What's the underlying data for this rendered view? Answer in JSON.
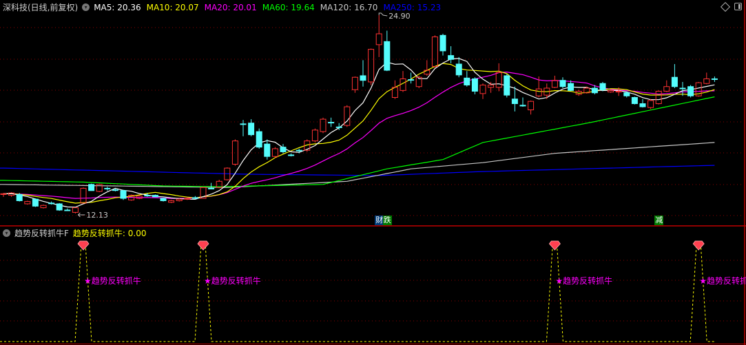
{
  "header": {
    "stock_title": "深科技(日线,前复权)",
    "ma_labels": [
      {
        "text": "MA5: 20.36",
        "color": "#FFFFFF"
      },
      {
        "text": "MA10: 20.07",
        "color": "#FFFF00"
      },
      {
        "text": "MA20: 20.01",
        "color": "#FF00FF"
      },
      {
        "text": "MA60: 19.64",
        "color": "#00FF00"
      },
      {
        "text": "MA120: 16.70",
        "color": "#C8C8C8"
      },
      {
        "text": "MA250: 15.23",
        "color": "#0000FF"
      }
    ]
  },
  "indicator": {
    "name": "趋势反转抓牛F",
    "value_label": "趋势反转抓牛: 0.00",
    "signal_text": "★趋势反转抓牛",
    "signal_indices": [
      10,
      25,
      69,
      87
    ]
  },
  "markers": [
    {
      "index": 47,
      "text": "财",
      "color": "#003C78"
    },
    {
      "index": 48,
      "text": "跌",
      "color": "#007800"
    },
    {
      "index": 82,
      "text": "减",
      "color": "#007800"
    }
  ],
  "colors": {
    "up": "#FF3232",
    "down": "#54FCFC",
    "grid": "#8B0000",
    "border": "#C00000"
  },
  "chart_data": {
    "type": "candlestick",
    "price_range": [
      12.13,
      24.9
    ],
    "high_label": "24.90",
    "low_label": "12.13",
    "ohlc": [
      [
        13.35,
        13.45,
        13.2,
        13.4
      ],
      [
        13.3,
        13.5,
        13.2,
        13.45
      ],
      [
        13.35,
        13.45,
        12.9,
        12.95
      ],
      [
        12.75,
        12.95,
        12.7,
        12.9
      ],
      [
        13.05,
        13.1,
        12.55,
        12.6
      ],
      [
        12.5,
        12.7,
        12.45,
        12.65
      ],
      [
        12.8,
        12.9,
        12.7,
        12.8
      ],
      [
        12.75,
        12.8,
        12.3,
        12.35
      ],
      [
        12.35,
        12.45,
        12.3,
        12.35
      ],
      [
        12.2,
        12.5,
        12.13,
        12.5
      ],
      [
        12.8,
        13.8,
        12.8,
        13.75
      ],
      [
        14.0,
        14.05,
        13.6,
        13.6
      ],
      [
        13.55,
        14.05,
        13.5,
        14.0
      ],
      [
        13.75,
        13.85,
        13.6,
        13.75
      ],
      [
        13.65,
        13.75,
        13.55,
        13.65
      ],
      [
        13.6,
        13.65,
        13.0,
        13.1
      ],
      [
        13.0,
        13.35,
        12.95,
        13.3
      ],
      [
        13.1,
        13.3,
        13.05,
        13.25
      ],
      [
        13.3,
        13.45,
        13.2,
        13.3
      ],
      [
        13.3,
        13.35,
        13.2,
        13.2
      ],
      [
        13.1,
        13.15,
        12.9,
        12.95
      ],
      [
        12.85,
        13.0,
        12.8,
        12.95
      ],
      [
        12.95,
        13.1,
        12.9,
        13.05
      ],
      [
        13.05,
        13.15,
        13.0,
        13.1
      ],
      [
        13.15,
        13.25,
        13.05,
        13.15
      ],
      [
        13.1,
        13.85,
        13.1,
        13.8
      ],
      [
        13.75,
        14.1,
        13.7,
        13.75
      ],
      [
        13.8,
        14.3,
        13.75,
        14.2
      ],
      [
        14.3,
        15.1,
        14.25,
        15.05
      ],
      [
        15.3,
        16.9,
        15.2,
        16.8
      ],
      [
        17.9,
        18.15,
        17.1,
        17.9
      ],
      [
        17.95,
        18.2,
        17.1,
        17.2
      ],
      [
        17.4,
        17.6,
        16.3,
        16.4
      ],
      [
        16.6,
        16.9,
        15.6,
        15.8
      ],
      [
        15.8,
        16.4,
        15.7,
        16.3
      ],
      [
        16.4,
        16.6,
        16.0,
        16.1
      ],
      [
        15.9,
        16.0,
        15.8,
        15.9
      ],
      [
        16.2,
        16.3,
        16.0,
        16.2
      ],
      [
        16.2,
        16.9,
        16.1,
        16.8
      ],
      [
        16.8,
        17.6,
        16.7,
        17.5
      ],
      [
        17.4,
        18.3,
        17.3,
        18.2
      ],
      [
        18.0,
        18.3,
        17.7,
        18.0
      ],
      [
        17.7,
        17.95,
        17.5,
        17.7
      ],
      [
        17.8,
        19.1,
        17.7,
        19.0
      ],
      [
        20.1,
        20.95,
        19.9,
        20.9
      ],
      [
        21.0,
        22.0,
        20.3,
        20.7
      ],
      [
        20.6,
        22.75,
        20.4,
        22.7
      ],
      [
        23.0,
        24.9,
        22.2,
        23.7
      ],
      [
        23.2,
        23.9,
        21.3,
        21.35
      ],
      [
        19.6,
        20.7,
        19.5,
        20.25
      ],
      [
        20.05,
        21.3,
        19.95,
        20.8
      ],
      [
        20.75,
        21.2,
        20.5,
        20.75
      ],
      [
        20.3,
        21.0,
        20.2,
        20.9
      ],
      [
        21.1,
        22.0,
        21.0,
        21.35
      ],
      [
        21.6,
        23.6,
        21.5,
        23.5
      ],
      [
        23.6,
        23.7,
        22.3,
        22.6
      ],
      [
        22.3,
        22.9,
        21.8,
        22.05
      ],
      [
        21.75,
        22.2,
        20.9,
        21.05
      ],
      [
        20.85,
        21.3,
        20.3,
        20.4
      ],
      [
        20.8,
        20.9,
        19.8,
        20.0
      ],
      [
        19.85,
        20.5,
        19.5,
        20.4
      ],
      [
        20.25,
        20.6,
        19.9,
        20.4
      ],
      [
        20.25,
        21.8,
        20.0,
        21.2
      ],
      [
        21.0,
        21.1,
        19.6,
        19.75
      ],
      [
        19.5,
        20.3,
        18.7,
        19.2
      ],
      [
        19.1,
        19.6,
        19.0,
        19.05
      ],
      [
        18.8,
        19.4,
        18.5,
        19.35
      ],
      [
        19.7,
        20.95,
        19.6,
        20.15
      ],
      [
        19.75,
        20.5,
        19.5,
        20.2
      ],
      [
        20.25,
        21.0,
        20.2,
        20.7
      ],
      [
        20.7,
        20.9,
        20.2,
        20.3
      ],
      [
        20.5,
        20.7,
        20.0,
        20.05
      ],
      [
        19.8,
        20.1,
        19.7,
        20.0
      ],
      [
        19.9,
        20.3,
        19.85,
        20.2
      ],
      [
        20.2,
        20.4,
        19.8,
        19.9
      ],
      [
        20.5,
        20.6,
        20.0,
        20.1
      ],
      [
        19.95,
        20.1,
        19.9,
        20.05
      ],
      [
        19.95,
        20.25,
        19.7,
        20.0
      ],
      [
        19.9,
        20.0,
        19.6,
        19.7
      ],
      [
        19.6,
        19.65,
        19.15,
        19.2
      ],
      [
        19.2,
        19.5,
        18.95,
        19.0
      ],
      [
        18.95,
        19.5,
        18.85,
        19.4
      ],
      [
        19.2,
        20.05,
        19.15,
        20.0
      ],
      [
        20.0,
        20.7,
        19.95,
        20.3
      ],
      [
        20.9,
        21.75,
        20.2,
        20.3
      ],
      [
        20.2,
        20.6,
        19.7,
        20.2
      ],
      [
        20.3,
        20.4,
        19.6,
        19.7
      ],
      [
        19.7,
        20.6,
        19.65,
        20.55
      ],
      [
        20.5,
        21.2,
        20.45,
        20.8
      ],
      [
        20.8,
        20.95,
        20.6,
        20.8
      ]
    ],
    "ma_long": {
      "MA60": [
        [
          0,
          14.26
        ],
        [
          10,
          14.15
        ],
        [
          20,
          13.9
        ],
        [
          27,
          13.85
        ],
        [
          40,
          14.0
        ],
        [
          48,
          15.0
        ],
        [
          55,
          15.6
        ],
        [
          60,
          16.7
        ],
        [
          73,
          17.94
        ],
        [
          89,
          19.64
        ]
      ],
      "MA120": [
        [
          0,
          14.0
        ],
        [
          28,
          13.8
        ],
        [
          43,
          14.2
        ],
        [
          51,
          15.0
        ],
        [
          60,
          15.4
        ],
        [
          69,
          16.0
        ],
        [
          89,
          16.7
        ]
      ],
      "MA250": [
        [
          0,
          15.05
        ],
        [
          30,
          14.66
        ],
        [
          47,
          14.57
        ],
        [
          60,
          14.83
        ],
        [
          89,
          15.23
        ]
      ]
    }
  }
}
